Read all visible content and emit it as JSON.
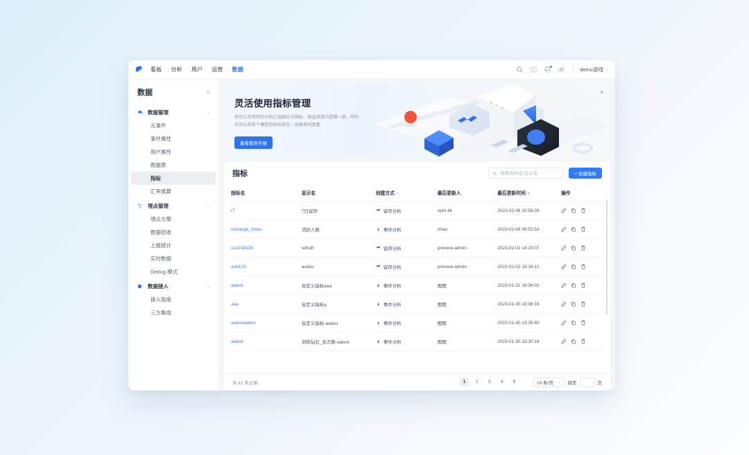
{
  "topnav": {
    "logo": "bird-logo-icon",
    "items": [
      {
        "label": "看板",
        "active": false
      },
      {
        "label": "分析",
        "active": false
      },
      {
        "label": "用户",
        "active": false
      },
      {
        "label": "运营",
        "active": false
      },
      {
        "label": "数据",
        "active": true
      }
    ],
    "icons": [
      "search-icon",
      "apps-grid-icon",
      "bell-icon",
      "gear-icon"
    ],
    "account": "demo游戏",
    "account_caret": "⌄"
  },
  "sidebar": {
    "title": "数据",
    "collapse_icon": "«",
    "groups": [
      {
        "label": "数据管理",
        "icon": "database-icon",
        "caret": "⌄",
        "items": [
          {
            "label": "元事件",
            "active": false
          },
          {
            "label": "事件属性",
            "active": false
          },
          {
            "label": "用户属性",
            "active": false
          },
          {
            "label": "数据表",
            "active": false
          },
          {
            "label": "指标",
            "active": true
          },
          {
            "label": "汇率换算",
            "active": false
          }
        ]
      },
      {
        "label": "埋点管理",
        "icon": "tracking-icon",
        "caret": "⌄",
        "items": [
          {
            "label": "埋点方案",
            "active": false
          },
          {
            "label": "数据验收",
            "active": false
          },
          {
            "label": "上报统计",
            "active": false
          },
          {
            "label": "实时数据",
            "active": false
          },
          {
            "label": "Debug 模式",
            "active": false
          }
        ]
      },
      {
        "label": "数据接入",
        "icon": "import-icon",
        "caret": "⌄",
        "items": [
          {
            "label": "接入指南",
            "active": false
          },
          {
            "label": "三方集成",
            "active": false
          }
        ]
      }
    ]
  },
  "banner": {
    "title": "灵活使用指标管理",
    "desc_line1": "你可以将常用的分析口径固化为指标，保证项目内逻辑一致，同时",
    "desc_line2": "也可以将各个模型的指标放在一张报表内查看",
    "button": "查看使用手册",
    "close_icon": "×",
    "accent": "#2f72f0"
  },
  "panel": {
    "title": "指标",
    "search_placeholder": "搜索指标名/显示名",
    "search_value": "",
    "create_button": "+ 创建指标",
    "columns": [
      {
        "label": "指标名",
        "sort": ""
      },
      {
        "label": "显示名",
        "sort": ""
      },
      {
        "label": "创建方式",
        "sort": "▽"
      },
      {
        "label": "最后更新人",
        "sort": ""
      },
      {
        "label": "最后更新时间",
        "sort": "⇅"
      },
      {
        "label": "操作",
        "sort": ""
      }
    ],
    "rows": [
      {
        "name": "r7",
        "display": "7日留存",
        "method": "留存分析",
        "method_type": "retention",
        "updater": "opm-kk",
        "time": "2023-02-06 10:58:26"
      },
      {
        "name": "recharge_times",
        "display": "活跃人数",
        "method": "事件分析",
        "method_type": "event",
        "updater": "zhao",
        "time": "2023-02-06 09:53:53"
      },
      {
        "name": "sss234324",
        "display": "sdfsdf",
        "method": "留存分析",
        "method_type": "retention",
        "updater": "preview-admin",
        "time": "2023-02-02 14:20:07"
      },
      {
        "name": "asd123",
        "display": "asdas",
        "method": "留存分析",
        "method_type": "retention",
        "updater": "preview-admin",
        "time": "2023-02-02 14:18:12"
      },
      {
        "name": "aatest",
        "display": "自定义指标aaa",
        "method": "事件分析",
        "method_type": "event",
        "updater": "图图",
        "time": "2023-01-31 18:38:02"
      },
      {
        "name": "aaa",
        "display": "自定义指标a",
        "method": "事件分析",
        "method_type": "event",
        "updater": "图图",
        "time": "2023-01-30 19:36:16"
      },
      {
        "name": "aatestaatest",
        "display": "自定义指标-aatest",
        "method": "事件分析",
        "method_type": "event",
        "updater": "图图",
        "time": "2023-01-30 13:35:40"
      },
      {
        "name": "aatest",
        "display": "消耗钻石_总次数-aatest",
        "method": "事件分析",
        "method_type": "event",
        "updater": "图图",
        "time": "2023-01-30 13:30:14"
      }
    ],
    "op_icons": [
      "edit-icon",
      "copy-icon",
      "delete-icon"
    ]
  },
  "footer": {
    "record_count": "共 43 条记录",
    "prev_icon": "←",
    "next_icon": "→",
    "pages": [
      "1",
      "2",
      "3",
      "4",
      "5"
    ],
    "active_page": "1",
    "page_size": "10 条/页",
    "page_size_caret": "⌄",
    "jump_label": "跳至",
    "jump_value": "",
    "jump_suffix": "页"
  }
}
